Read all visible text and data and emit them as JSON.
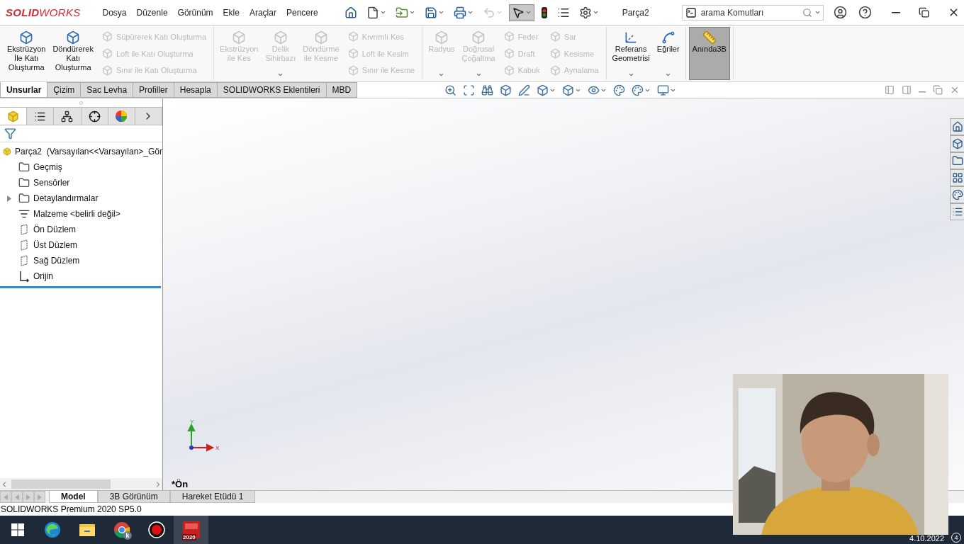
{
  "title_bar": {
    "logo": "**SOLID**WORKS",
    "menus": [
      {
        "label": "Dosya"
      },
      {
        "label": "Düzenle"
      },
      {
        "label": "Görünüm"
      },
      {
        "label": "Ekle"
      },
      {
        "label": "Araçlar"
      },
      {
        "label": "Pencere"
      }
    ],
    "quick_access": [
      {
        "dropdown": false,
        "disabled": false,
        "pressed": false
      },
      {
        "dropdown": true,
        "disabled": false,
        "pressed": false
      },
      {
        "dropdown": true,
        "disabled": false,
        "pressed": false
      },
      {
        "dropdown": true,
        "disabled": false,
        "pressed": false
      },
      {
        "dropdown": true,
        "disabled": false,
        "pressed": false
      },
      {
        "dropdown": true,
        "disabled": true,
        "pressed": false
      },
      {
        "dropdown": true,
        "disabled": false,
        "pressed": true
      },
      {
        "dropdown": false,
        "disabled": false,
        "pressed": false
      },
      {
        "dropdown": false,
        "disabled": false,
        "pressed": false
      },
      {
        "dropdown": true,
        "disabled": false,
        "pressed": false
      }
    ],
    "document_title": "Parça2",
    "search": {
      "placeholder": "arama Komutları"
    }
  },
  "ribbon": {
    "groups": [
      {
        "columns": [
          {
            "kind": "large",
            "label": "Ekstrüzyon\nİle Katı\nOluşturma",
            "disabled": false,
            "dropdown": false,
            "pressed": false
          },
          {
            "kind": "large",
            "label": "Döndürerek\nKatı\nOluşturma",
            "disabled": false,
            "dropdown": false,
            "pressed": false
          },
          {
            "kind": "stack",
            "items": [
              {
                "label": "Süpürerek Katı Oluşturma",
                "disabled": true
              },
              {
                "label": "Loft ile Katı Oluşturma",
                "disabled": true
              },
              {
                "label": "Sınır ile Katı Oluşturma",
                "disabled": true
              }
            ]
          }
        ]
      },
      {
        "columns": [
          {
            "kind": "large",
            "label": "Ekstrüzyon\nile Kes",
            "disabled": true,
            "dropdown": false,
            "pressed": false
          },
          {
            "kind": "large",
            "label": "Delik\nSihirbazı",
            "disabled": true,
            "dropdown": true,
            "pressed": false
          },
          {
            "kind": "large",
            "label": "Döndürme\nile Kesme",
            "disabled": true,
            "dropdown": false,
            "pressed": false
          },
          {
            "kind": "stack",
            "items": [
              {
                "label": "Kıvrımlı Kes",
                "disabled": true
              },
              {
                "label": "Loft ile Kesim",
                "disabled": true
              },
              {
                "label": "Sınır ile Kesme",
                "disabled": true
              }
            ]
          }
        ]
      },
      {
        "columns": [
          {
            "kind": "large",
            "label": "Radyus",
            "disabled": true,
            "dropdown": true,
            "pressed": false
          },
          {
            "kind": "large",
            "label": "Doğrusal\nÇoğaltma",
            "disabled": true,
            "dropdown": true,
            "pressed": false
          },
          {
            "kind": "stack",
            "items": [
              {
                "label": "Feder",
                "disabled": true
              },
              {
                "label": "Draft",
                "disabled": true
              },
              {
                "label": "Kabuk",
                "disabled": true
              }
            ]
          },
          {
            "kind": "stack",
            "items": [
              {
                "label": "Sar",
                "disabled": true
              },
              {
                "label": "Kesisme",
                "disabled": true
              },
              {
                "label": "Aynalama",
                "disabled": true
              }
            ]
          }
        ]
      },
      {
        "columns": [
          {
            "kind": "large",
            "label": "Referans\nGeometrisi",
            "disabled": false,
            "dropdown": true,
            "pressed": false
          },
          {
            "kind": "large",
            "label": "Eğriler",
            "disabled": false,
            "dropdown": true,
            "pressed": false
          }
        ]
      },
      {
        "columns": [
          {
            "kind": "large",
            "label": "Anında3B",
            "disabled": false,
            "dropdown": false,
            "pressed": true
          }
        ]
      }
    ]
  },
  "command_tabs": [
    {
      "label": "Unsurlar",
      "selected": true
    },
    {
      "label": "Çizim",
      "selected": false
    },
    {
      "label": "Sac Levha",
      "selected": false
    },
    {
      "label": "Profiller",
      "selected": false
    },
    {
      "label": "Hesapla",
      "selected": false
    },
    {
      "label": "SOLIDWORKS Eklentileri",
      "selected": false
    },
    {
      "label": "MBD",
      "selected": false
    }
  ],
  "view_toolbar": [
    {
      "dropdown": false
    },
    {
      "dropdown": false
    },
    {
      "dropdown": false
    },
    {
      "dropdown": false
    },
    {
      "dropdown": false
    },
    {
      "dropdown": true
    },
    {
      "dropdown": true
    },
    {
      "dropdown": true
    },
    {
      "dropdown": false
    },
    {
      "dropdown": true
    },
    {
      "dropdown": true
    }
  ],
  "feature_manager": {
    "tabs": [
      {
        "selected": true
      },
      {
        "selected": false
      },
      {
        "selected": false
      },
      {
        "selected": false
      },
      {
        "selected": false
      }
    ],
    "tree": {
      "kind": "part",
      "label": "Parça2  (Varsayılan<<Varsayılan>_Gör",
      "children": [
        {
          "kind": "history",
          "label": "Geçmiş"
        },
        {
          "kind": "sensors",
          "label": "Sensörler"
        },
        {
          "kind": "annotations",
          "label": "Detaylandırmalar",
          "expanded": false
        },
        {
          "kind": "material",
          "label": "Malzeme <belirli değil>"
        },
        {
          "kind": "plane",
          "label": "Ön Düzlem"
        },
        {
          "kind": "plane",
          "label": "Üst Düzlem"
        },
        {
          "kind": "plane",
          "label": "Sağ Düzlem"
        },
        {
          "kind": "origin",
          "label": "Orijin"
        }
      ]
    }
  },
  "graphics": {
    "view_label": "*Ön",
    "triad": {
      "y_label": "Y",
      "x_label": "X"
    }
  },
  "bottom_tabs": [
    {
      "label": "Model",
      "selected": true
    },
    {
      "label": "3B Görünüm",
      "selected": false
    },
    {
      "label": "Hareket Etüdü 1",
      "selected": false
    }
  ],
  "status_bar": {
    "text": "SOLIDWORKS Premium 2020 SP5.0"
  },
  "taskbar": {
    "apps": [
      {
        "kind": "start",
        "active": false
      },
      {
        "kind": "edge",
        "active": false
      },
      {
        "kind": "folder",
        "active": false
      },
      {
        "kind": "chrome",
        "badge": "k",
        "active": false
      },
      {
        "kind": "recorder",
        "active": false
      },
      {
        "kind": "solidworks",
        "badge": "2020",
        "active": true
      }
    ],
    "date": "4.10.2022",
    "notifications": "4"
  }
}
